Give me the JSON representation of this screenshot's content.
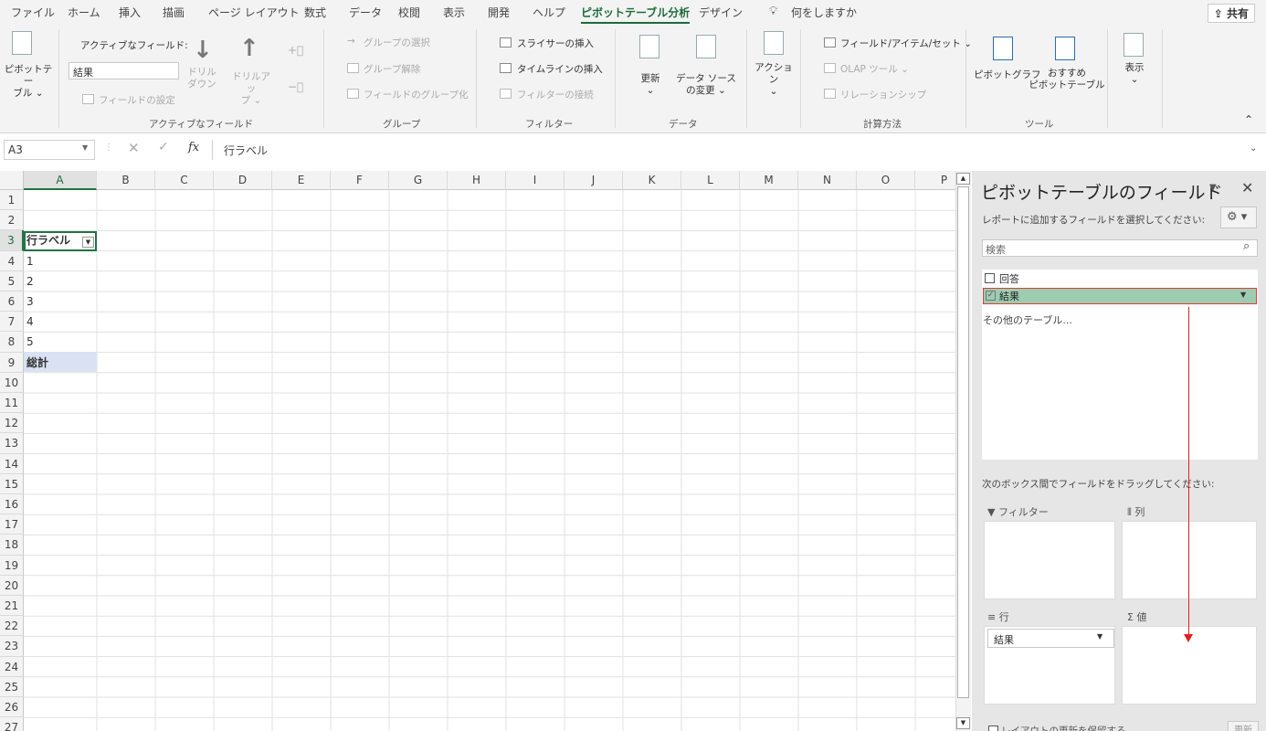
{
  "menubar": {
    "items": [
      "ファイル",
      "ホーム",
      "挿入",
      "描画",
      "ページ レイアウト",
      "数式",
      "データ",
      "校閲",
      "表示",
      "開発",
      "ヘルプ",
      "ピボットテーブル分析",
      "デザイン",
      "何をしますか"
    ],
    "active_index": 11,
    "share_label": "共有"
  },
  "ribbon": {
    "pivot_table": "ピボットテー\nブル ⌄",
    "active_field_label": "アクティブなフィールド:",
    "active_field_value": "結果",
    "drill_down": "ドリル\nダウン",
    "drill_up": "ドリルアッ\nプ ⌄",
    "field_settings": "フィールドの設定",
    "group_active_field": "アクティブなフィールド",
    "group_selection": "グループの選択",
    "ungroup": "グループ解除",
    "group_field": "フィールドのグループ化",
    "group_group": "グループ",
    "insert_slicer": "スライサーの挿入",
    "insert_timeline": "タイムラインの挿入",
    "filter_connections": "フィルターの接続",
    "group_filter": "フィルター",
    "refresh": "更新\n⌄",
    "change_source": "データ ソース\nの変更 ⌄",
    "group_data": "データ",
    "actions": "アクション\n⌄",
    "fields_items_sets": "フィールド/アイテム/セット ⌄",
    "olap_tools": "OLAP ツール ⌄",
    "relationships": "リレーションシップ",
    "group_calc": "計算方法",
    "pivot_chart": "ピボットグラフ",
    "recommended": "おすすめ\nピボットテーブル",
    "group_tools": "ツール",
    "show": "表示\n⌄"
  },
  "formula": {
    "namebox": "A3",
    "content": "行ラベル"
  },
  "grid": {
    "columns": [
      "A",
      "B",
      "C",
      "D",
      "E",
      "F",
      "G",
      "H",
      "I",
      "J",
      "K",
      "L",
      "M",
      "N",
      "O",
      "P"
    ],
    "rows": [
      "1",
      "2",
      "3",
      "4",
      "5",
      "6",
      "7",
      "8",
      "9",
      "10",
      "11",
      "12",
      "13",
      "14",
      "15",
      "16",
      "17",
      "18",
      "19",
      "20",
      "21",
      "22",
      "23",
      "24",
      "25",
      "26",
      "27"
    ],
    "selected_col": "A",
    "selected_row": "3",
    "cells": [
      {
        "row": 3,
        "value": "行ラベル"
      },
      {
        "row": 4,
        "value": "1"
      },
      {
        "row": 5,
        "value": "2"
      },
      {
        "row": 6,
        "value": "3"
      },
      {
        "row": 7,
        "value": "4"
      },
      {
        "row": 8,
        "value": "5"
      },
      {
        "row": 9,
        "value": "総計"
      }
    ]
  },
  "pane": {
    "title": "ピボットテーブルのフィールド",
    "hint": "レポートに追加するフィールドを選択してください:",
    "search_placeholder": "検索",
    "fields": [
      {
        "label": "回答",
        "checked": false
      },
      {
        "label": "結果",
        "checked": true
      }
    ],
    "more_tables": "その他のテーブル...",
    "drag_hint": "次のボックス間でフィールドをドラッグしてください:",
    "area_filter": "フィルター",
    "area_columns": "列",
    "area_rows": "行",
    "area_values": "値",
    "row_chip": "結果",
    "defer_label": "レイアウトの更新を保留する",
    "update_label": "更新"
  },
  "colors": {
    "accent": "#217346",
    "highlight_field": "#9ccdb0",
    "annotation": "#e02020"
  }
}
